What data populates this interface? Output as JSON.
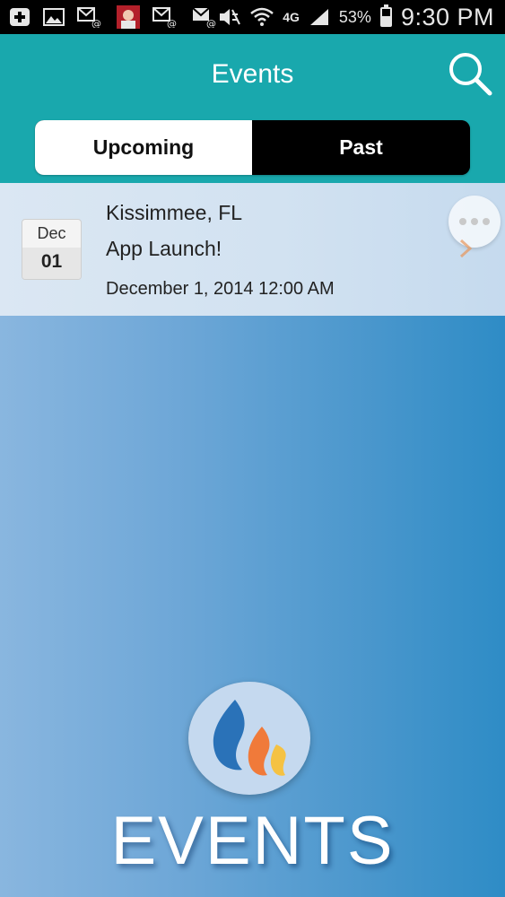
{
  "status_bar": {
    "icons": [
      "add-icon",
      "gallery-icon",
      "email-icon",
      "app-icon",
      "email-icon",
      "email-icon",
      "mute-icon",
      "wifi-icon",
      "signal-icon"
    ],
    "network": "4G",
    "battery_percent": "53%",
    "battery_level": 0.53,
    "time": "9:30 PM"
  },
  "header": {
    "title": "Events",
    "tabs": {
      "upcoming": "Upcoming",
      "past": "Past"
    },
    "active_tab": "upcoming"
  },
  "events": [
    {
      "month": "Dec",
      "day": "01",
      "location": "Kissimmee, FL",
      "name": "App Launch!",
      "datetime": "December 1, 2014 12:00 AM"
    }
  ],
  "logo": {
    "text": "EVENTS"
  },
  "colors": {
    "header": "#19a8ad",
    "tab_active": "#ffffff",
    "tab_inactive": "#000000",
    "flame_blue": "#2a72b8",
    "flame_orange": "#f07a3a",
    "flame_yellow": "#f5c243"
  }
}
